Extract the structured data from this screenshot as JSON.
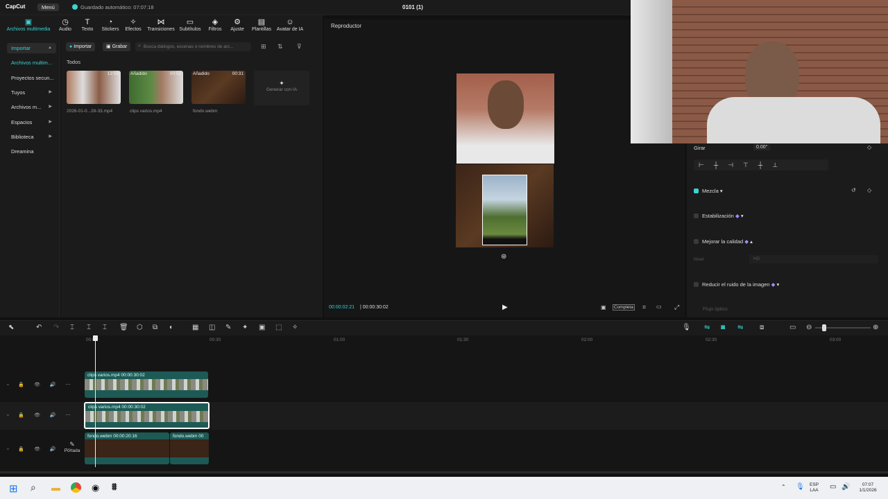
{
  "app": {
    "logo": "CapCut",
    "menu_label": "Menú",
    "saved_status": "Guardado automático: 07:07:18",
    "project_name": "0101 (1)"
  },
  "toolbar": {
    "tools": [
      "Archivos multimedia",
      "Audio",
      "Texto",
      "Stickers",
      "Efectos",
      "Transiciones",
      "Subtítulos",
      "Filtros",
      "Ajuste",
      "Plantillas",
      "Avatar de IA"
    ]
  },
  "sidebar": {
    "items": [
      "Importar",
      "Archivos multim...",
      "Proyectos secun...",
      "Tuyos",
      "Archivos m...",
      "Espacios",
      "Biblioteca",
      "Dreamina"
    ]
  },
  "media": {
    "import_label": "Importar",
    "record_label": "Grabar",
    "search_placeholder": "Busca diálogos, escenas o nombres de arc...",
    "filter_label": "Todos",
    "items": [
      {
        "name": "2026-01-0...28-33.mp4",
        "tag": "",
        "duration": "13:59"
      },
      {
        "name": "clips varios.mp4",
        "tag": "Añadido",
        "duration": "00:52"
      },
      {
        "name": "fondo.webm",
        "tag": "Añadido",
        "duration": "00:31"
      }
    ],
    "ai_label": "Generar con IA"
  },
  "player": {
    "title": "Reproductor",
    "current_time": "00:00:02:21",
    "total_time": "00:00:30:02",
    "ratio_label": "Completa"
  },
  "properties": {
    "rotate_label": "Girar",
    "rotate_value": "0.00°",
    "blend_label": "Mezcla",
    "stabilize_label": "Estabilización",
    "quality_label": "Mejorar la calidad",
    "level_label": "Nivel",
    "level_value": "HD",
    "denoise_label": "Reducir el ruido de la imagen",
    "optical_label": "Flujo óptico"
  },
  "timeline": {
    "ruler": [
      "00:00",
      "00:30",
      "01:00",
      "01:30",
      "02:00",
      "02:30",
      "03:00"
    ],
    "cover_label": "Portada",
    "clips": [
      {
        "label": "clips varios.mp4   00:00:30:02"
      },
      {
        "label": "clips varios.mp4   00:00:30:02"
      },
      {
        "label": "fondo.webm   00:00:20:16"
      },
      {
        "label": "fondo.webm   00"
      }
    ]
  },
  "taskbar": {
    "lang": "ESP",
    "lang2": "LAA",
    "time": "07:07",
    "date": "1/1/2026"
  },
  "colors": {
    "accent": "#3ad3d3",
    "clip": "#1d5a55",
    "panel": "#1b1b1b"
  }
}
